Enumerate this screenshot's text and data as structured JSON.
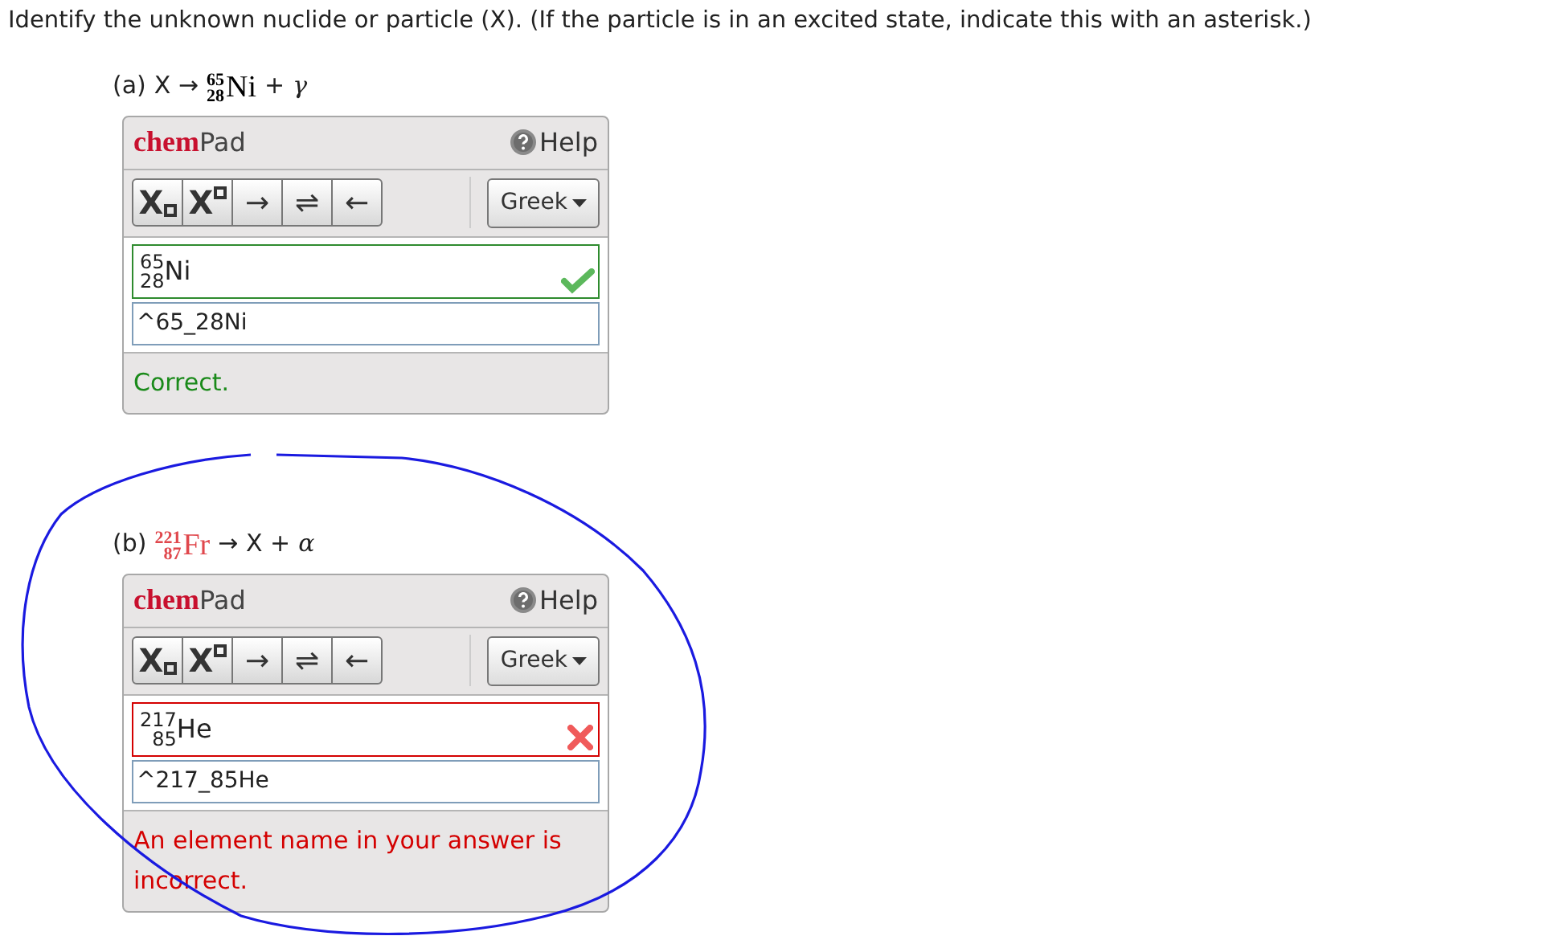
{
  "question": "Identify the unknown nuclide or particle (X). (If the particle is in an excited state, indicate this with an asterisk.)",
  "parts": [
    {
      "label": "(a)",
      "equation": [
        {
          "kind": "text",
          "text": "X →"
        },
        {
          "kind": "nuclide",
          "mass": "65",
          "atomic": "28",
          "symbol": "Ni",
          "highlighted": false
        },
        {
          "kind": "text",
          "text": "+"
        },
        {
          "kind": "greek",
          "text": "γ"
        }
      ],
      "pad": {
        "brand": "chem",
        "name": "Pad",
        "help": "Help",
        "tools": [
          {
            "kind": "subscript",
            "text": "X"
          },
          {
            "kind": "superscript",
            "text": "X"
          },
          {
            "kind": "text",
            "text": "→"
          },
          {
            "kind": "text",
            "text": "⇌"
          },
          {
            "kind": "text",
            "text": "←"
          }
        ],
        "greek": "Greek",
        "preview": {
          "mass": "65",
          "atomic": "28",
          "symbol": "Ni"
        },
        "correct": true,
        "value": "^65_28Ni",
        "feedback": "Correct."
      }
    },
    {
      "label": "(b)",
      "equation": [
        {
          "kind": "nuclide",
          "mass": "221",
          "atomic": "87",
          "symbol": "Fr",
          "highlighted": true
        },
        {
          "kind": "text",
          "text": "→ X +"
        },
        {
          "kind": "greek",
          "text": "α"
        }
      ],
      "pad": {
        "brand": "chem",
        "name": "Pad",
        "help": "Help",
        "tools": [
          {
            "kind": "subscript",
            "text": "X"
          },
          {
            "kind": "superscript",
            "text": "X"
          },
          {
            "kind": "text",
            "text": "→"
          },
          {
            "kind": "text",
            "text": "⇌"
          },
          {
            "kind": "text",
            "text": "←"
          }
        ],
        "greek": "Greek",
        "preview": {
          "mass": "217",
          "atomic": "85",
          "symbol": "He"
        },
        "correct": false,
        "value": "^217_85He",
        "feedback": "An element name in your answer is incorrect."
      }
    }
  ]
}
